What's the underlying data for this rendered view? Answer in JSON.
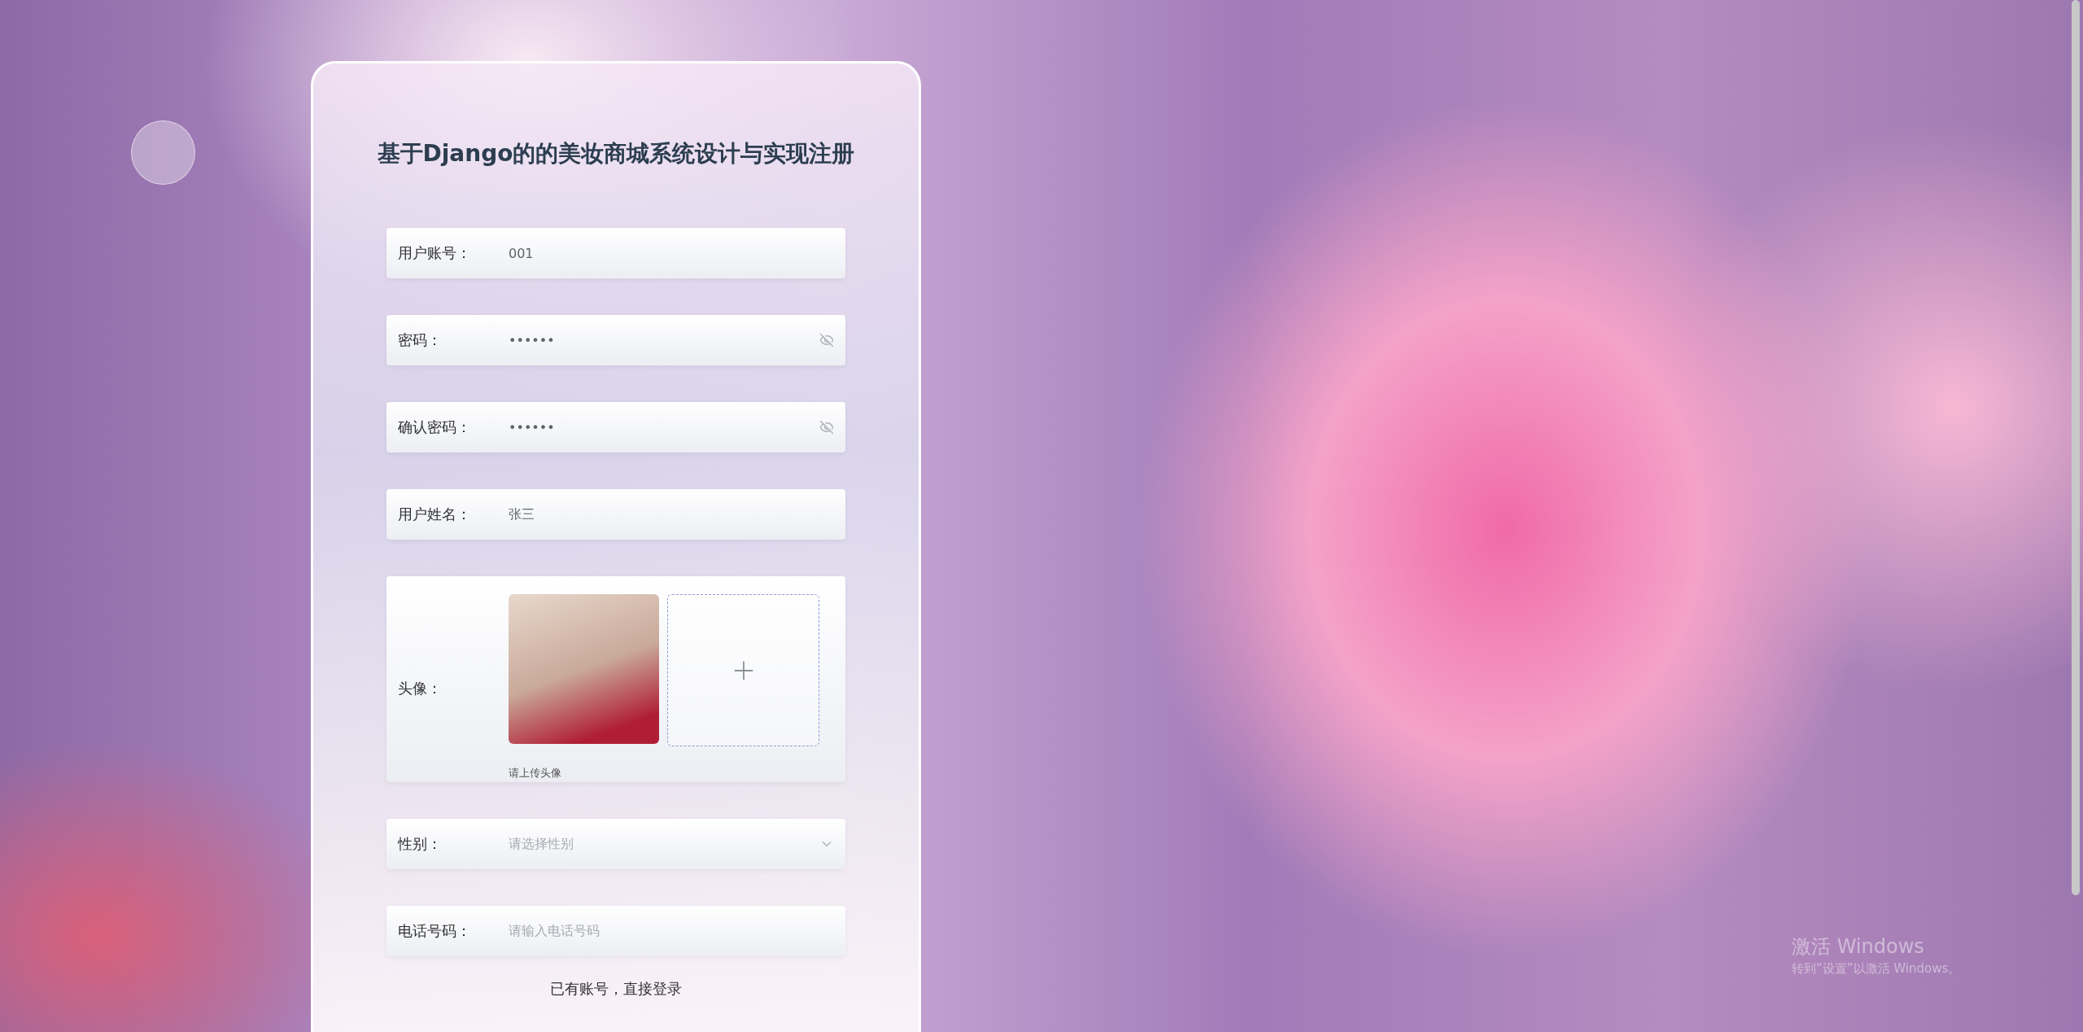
{
  "title": "基于Django的的美妆商城系统设计与实现注册",
  "fields": [
    {
      "kind": "text",
      "label": "用户账号：",
      "value": "001"
    },
    {
      "kind": "password",
      "label": "密码：",
      "value": "••••••"
    },
    {
      "kind": "password",
      "label": "确认密码：",
      "value": "••••••"
    },
    {
      "kind": "text",
      "label": "用户姓名：",
      "value": "张三"
    },
    {
      "kind": "upload",
      "label": "头像：",
      "hint": "请上传头像"
    },
    {
      "kind": "select",
      "label": "性别：",
      "placeholder": "请选择性别"
    },
    {
      "kind": "text",
      "label": "电话号码：",
      "placeholder": "请输入电话号码"
    }
  ],
  "login_link": "已有账号，直接登录",
  "os_notice": {
    "title": "激活 Windows",
    "subtitle": "转到“设置”以激活 Windows。"
  }
}
